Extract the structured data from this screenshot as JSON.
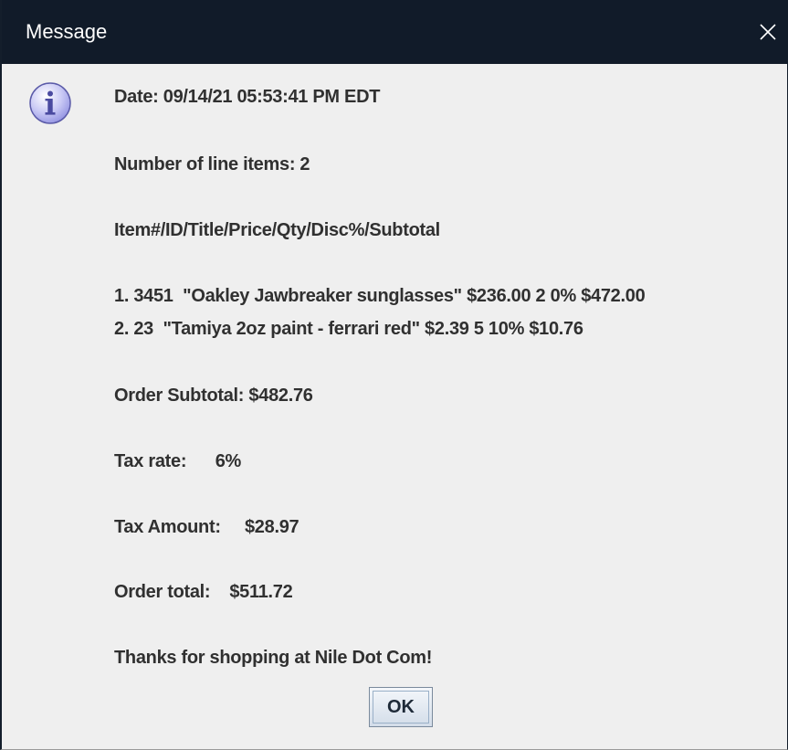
{
  "window": {
    "title": "Message",
    "close_glyph": "✕"
  },
  "icon": {
    "name": "info-icon",
    "glyph": "i"
  },
  "message": {
    "date": "Date: 09/14/21 05:53:41 PM EDT",
    "line_item_count": "Number of line items: 2",
    "header": "Item#/ID/Title/Price/Qty/Disc%/Subtotal",
    "items": [
      "1. 3451  \"Oakley Jawbreaker sunglasses\" $236.00 2 0% $472.00",
      "2. 23  \"Tamiya 2oz paint - ferrari red\" $2.39 5 10% $10.76"
    ],
    "order_subtotal": "Order Subtotal: $482.76",
    "tax_rate": "Tax rate:      6%",
    "tax_amount": "Tax Amount:     $28.97",
    "order_total": "Order total:    $511.72",
    "thanks": "Thanks for shopping at Nile Dot Com!"
  },
  "buttons": {
    "ok_label": "OK"
  },
  "colors": {
    "titlebar": "#111b29",
    "dialog_bg": "#efefef",
    "text": "#303030",
    "icon_fill": "#b9b9f0",
    "icon_border": "#5a5aa8"
  }
}
